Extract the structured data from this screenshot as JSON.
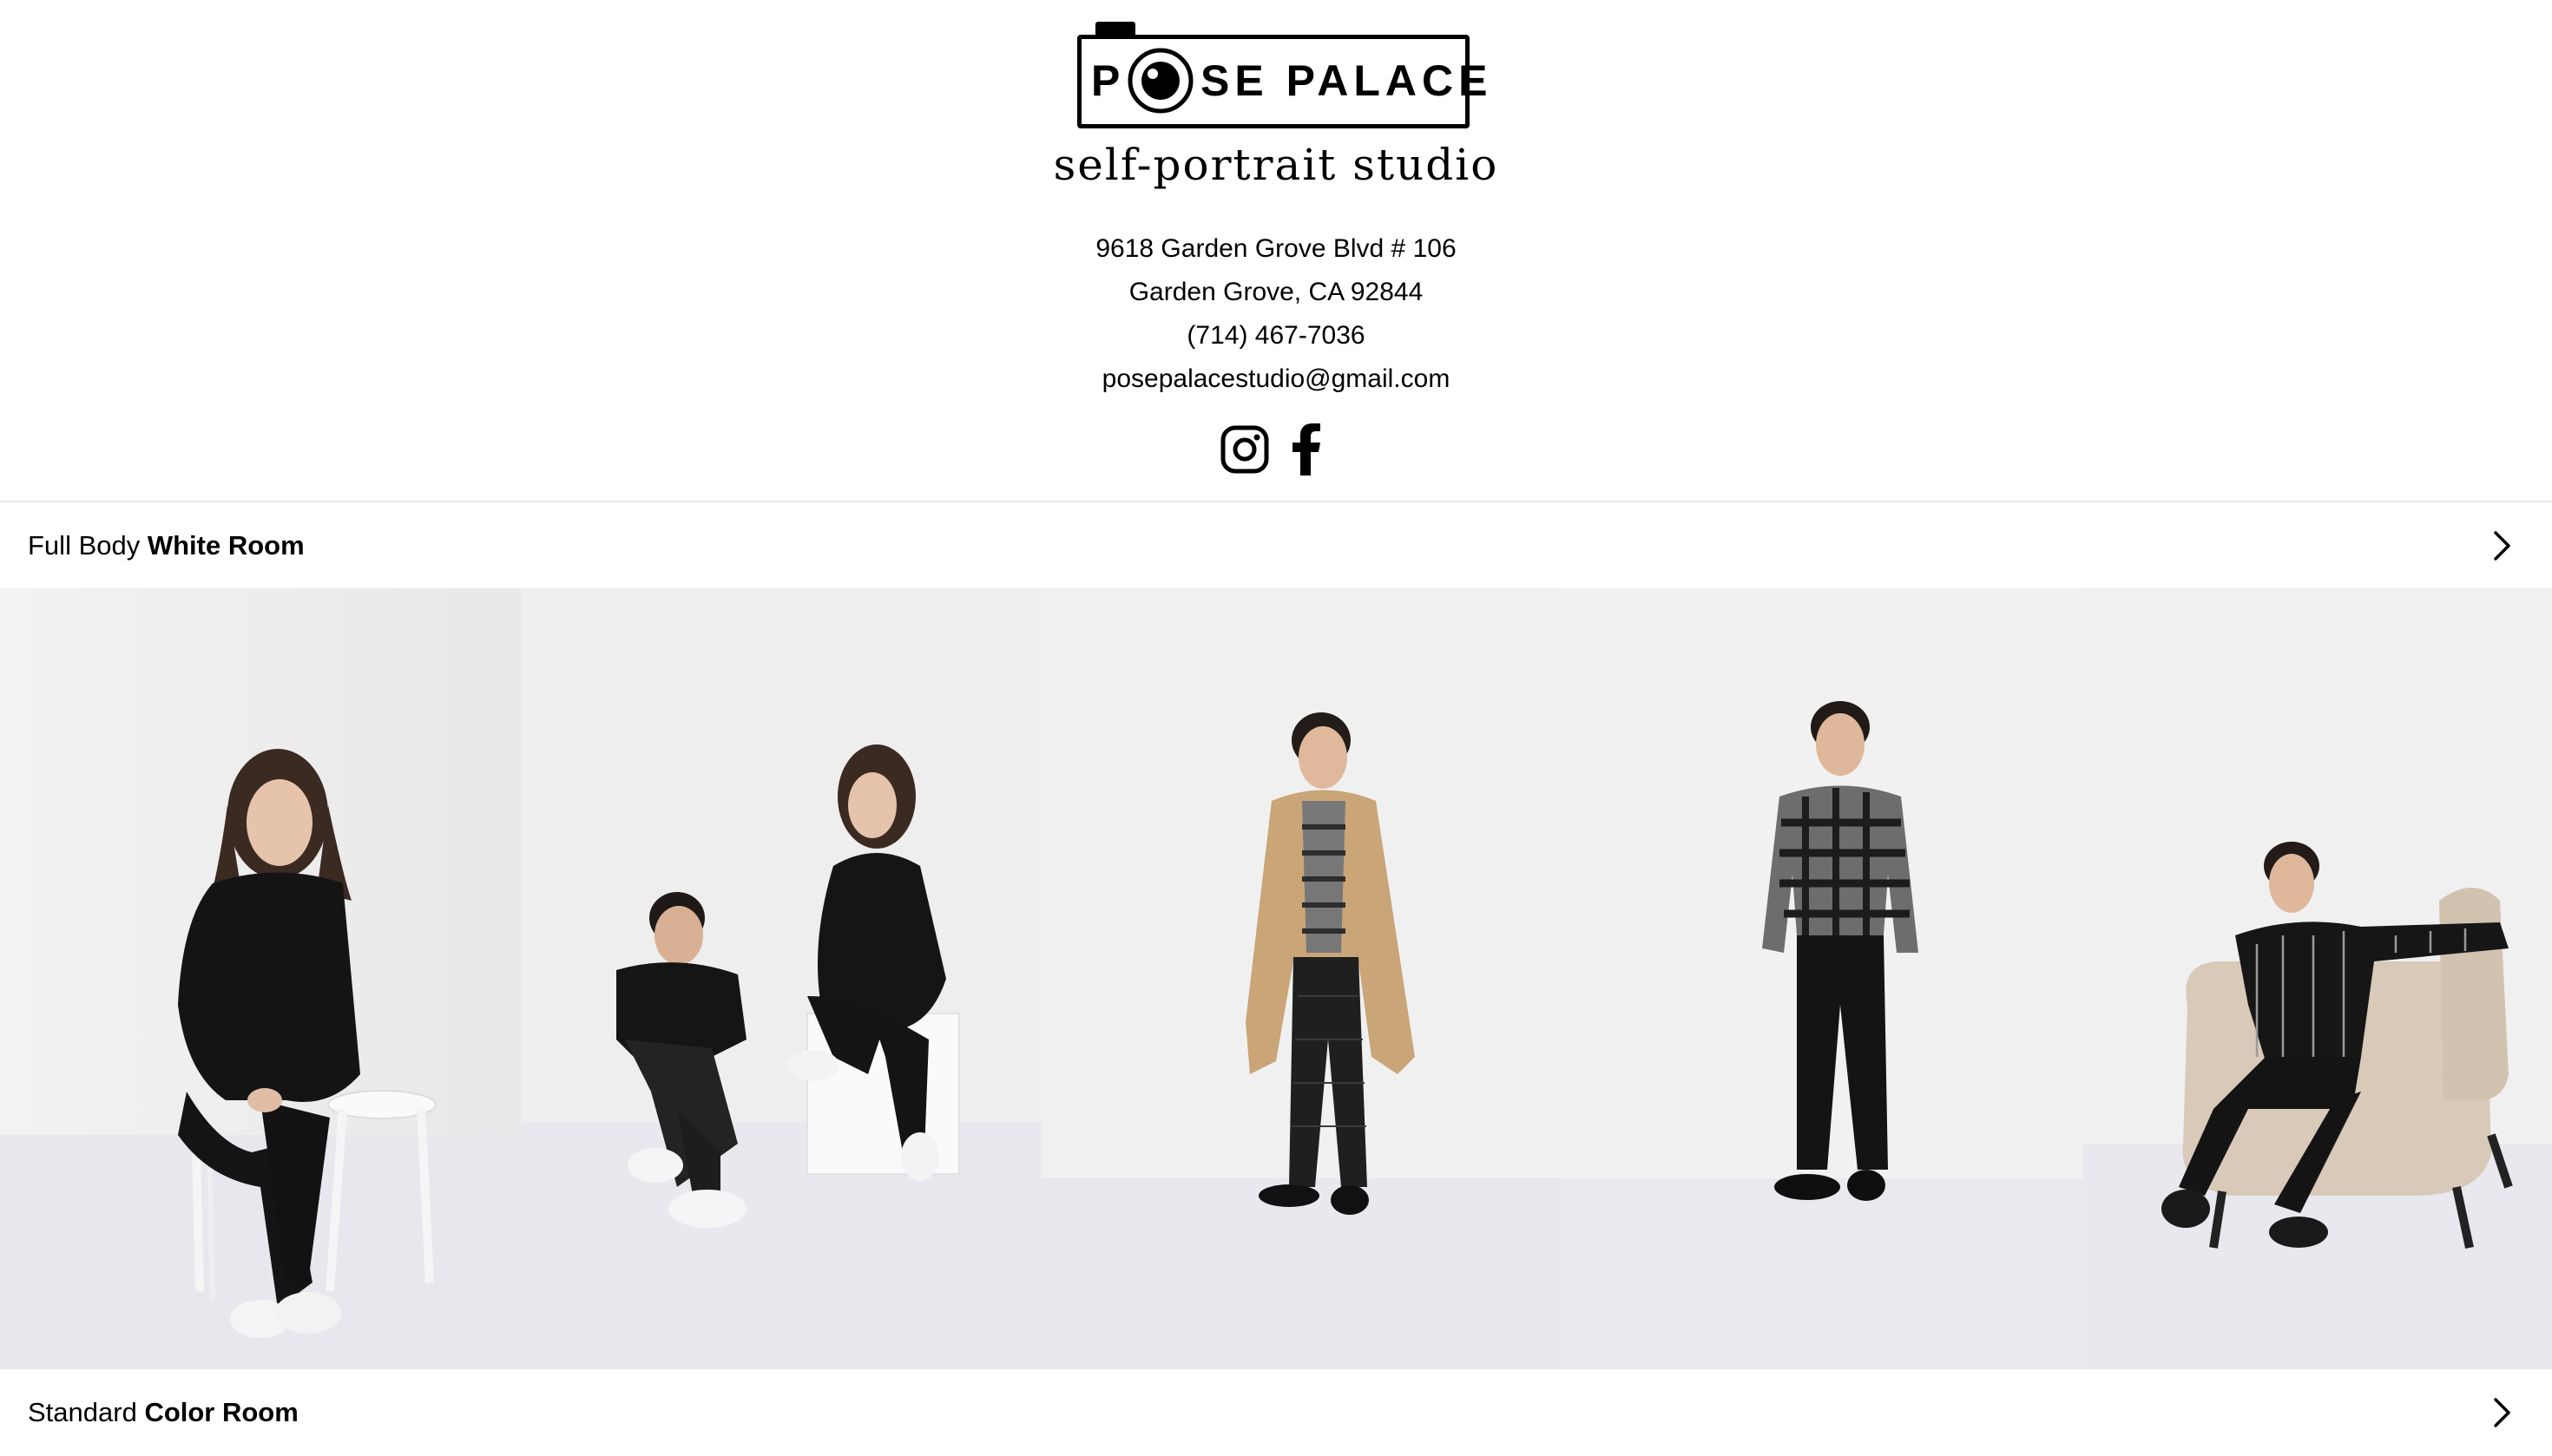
{
  "brand": {
    "logo_p": "P",
    "logo_rest": "SE PALACE",
    "tagline": "self-portrait studio"
  },
  "contact": {
    "address_line1": "9618 Garden Grove Blvd # 106",
    "address_line2": "Garden Grove, CA 92844",
    "phone": "(714) 467-7036",
    "email": "posepalacestudio@gmail.com"
  },
  "social": [
    {
      "icon": "instagram-icon"
    },
    {
      "icon": "facebook-icon"
    }
  ],
  "sections": [
    {
      "title_regular": "Full Body ",
      "title_bold": "White Room",
      "icon": "chevron-right-icon"
    },
    {
      "title_regular": "Standard ",
      "title_bold": "Color Room",
      "icon": "chevron-right-icon"
    }
  ],
  "gallery": {
    "photos": [
      {
        "subject": "woman-black-outfit-seated-stool"
      },
      {
        "subject": "couple-seated-floor-and-cube"
      },
      {
        "subject": "man-camel-coat-standing"
      },
      {
        "subject": "man-plaid-shirt-standing"
      },
      {
        "subject": "man-striped-shirt-armchair"
      }
    ]
  },
  "colors": {
    "background": "#ffffff",
    "text": "#000000",
    "divider": "#e6e6e6",
    "studio_wall": "#efeeef",
    "studio_floor": "#e7e6ec"
  }
}
